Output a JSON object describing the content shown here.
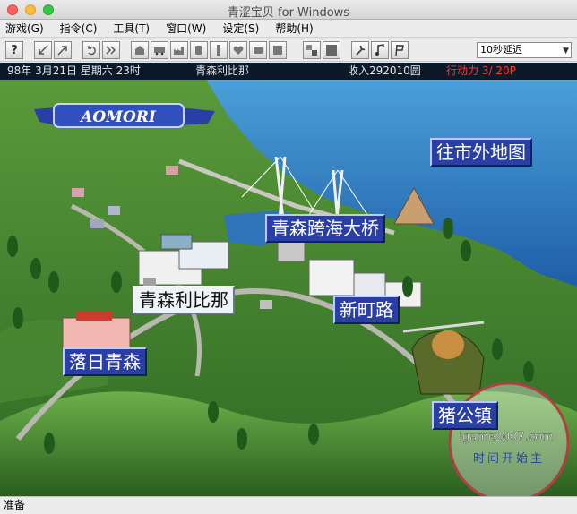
{
  "window": {
    "title": "青涩宝贝 for Windows"
  },
  "menu": [
    "游戏(G)",
    "指令(C)",
    "工具(T)",
    "窗口(W)",
    "设定(S)",
    "帮助(H)"
  ],
  "toolbar": {
    "delay": "10秒延迟",
    "help_glyph": "?"
  },
  "infobar": {
    "date": "98年 3月21日 星期六 23时",
    "location": "青森利比那",
    "income": "收入292010圆",
    "action": "行动力 3/ 20P"
  },
  "map": {
    "banner": "AOMORI",
    "labels": {
      "to_outer": "往市外地图",
      "bridge": "青森跨海大桥",
      "libina": "青森利比那",
      "shinmachi": "新町路",
      "sunset": "落日青森",
      "boar": "猪公镇"
    },
    "watermark": {
      "site": "igame2007.com",
      "text": "时间开始主"
    }
  },
  "status": "准备",
  "colors": {
    "sea": "#2a6ab0",
    "grass": "#3f7b2d",
    "label_blue": "#2a3fa6",
    "action_red": "#ff3a2a"
  }
}
